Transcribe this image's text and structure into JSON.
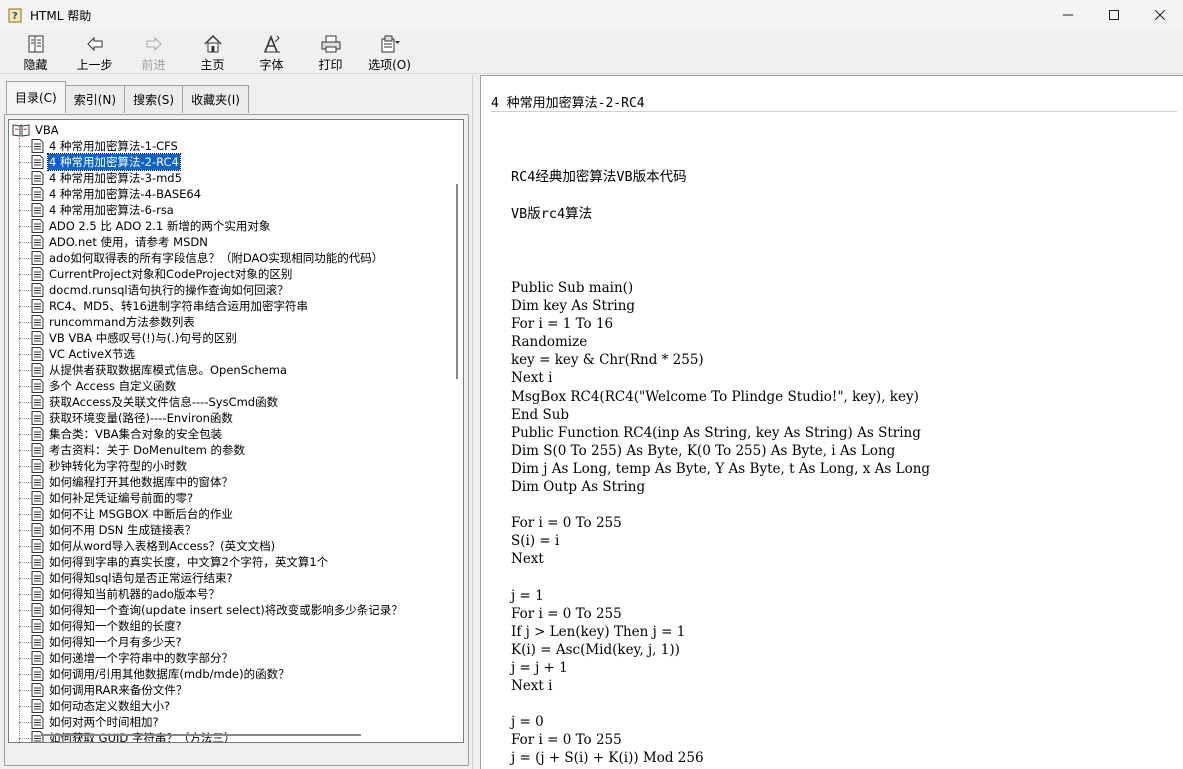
{
  "window": {
    "title": "HTML 帮助"
  },
  "toolbar": {
    "buttons": [
      {
        "label": "隐藏",
        "icon": "hide-icon",
        "enabled": true
      },
      {
        "label": "上一步",
        "icon": "back-arrow-icon",
        "enabled": true
      },
      {
        "label": "前进",
        "icon": "forward-arrow-icon",
        "enabled": false
      },
      {
        "label": "主页",
        "icon": "home-icon",
        "enabled": true
      },
      {
        "label": "字体",
        "icon": "font-icon",
        "enabled": true
      },
      {
        "label": "打印",
        "icon": "printer-icon",
        "enabled": true
      },
      {
        "label": "选项(O)",
        "icon": "options-icon",
        "enabled": true
      }
    ]
  },
  "nav_tabs": [
    {
      "label": "目录(C)",
      "active": true
    },
    {
      "label": "索引(N)",
      "active": false
    },
    {
      "label": "搜索(S)",
      "active": false
    },
    {
      "label": "收藏夹(I)",
      "active": false
    }
  ],
  "tree": {
    "root": "VBA",
    "items": [
      "4 种常用加密算法-1-CFS",
      "4 种常用加密算法-2-RC4",
      "4 种常用加密算法-3-md5",
      "4 种常用加密算法-4-BASE64",
      "4 种常用加密算法-6-rsa",
      "ADO 2.5 比 ADO 2.1 新增的两个实用对象",
      "ADO.net 使用，请参考 MSDN",
      "ado如何取得表的所有字段信息？（附DAO实现相同功能的代码）",
      "CurrentProject对象和CodeProject对象的区别",
      "docmd.runsql语句执行的操作查询如何回滚？",
      "RC4、MD5、转16进制字符串结合运用加密字符串",
      "runcommand方法参数列表",
      "VB VBA 中感叹号(!)与(.)句号的区别",
      "VC ActiveX节选",
      "从提供者获取数据库模式信息。OpenSchema",
      "多个 Access 自定义函数",
      "获取Access及关联文件信息----SysCmd函数",
      "获取环境变量(路径)----Environ函数",
      "集合类：VBA集合对象的安全包装",
      "考古资料：关于 DoMenuItem 的参数",
      "秒钟转化为字符型的小时数",
      "如何编程打开其他数据库中的窗体？",
      "如何补足凭证编号前面的零?",
      "如何不让 MSGBOX 中断后台的作业",
      "如何不用 DSN 生成链接表？",
      "如何从word导入表格到Access？(英文文档)",
      "如何得到字串的真实长度，中文算2个字符，英文算1个",
      "如何得知sql语句是否正常运行结束?",
      "如何得知当前机器的ado版本号？",
      "如何得知一个查询(update insert select)将改变或影响多少条记录？",
      "如何得知一个数组的长度?",
      "如何得知一个月有多少天?",
      "如何递增一个字符串中的数字部分？",
      "如何调用/引用其他数据库(mdb/mde)的函数？",
      "如何调用RAR来备份文件？",
      "如何动态定义数组大小?",
      "如何对两个时间相加?",
      "如何获取 GUID 字符串？（方法三）"
    ],
    "selected_index": 1
  },
  "topic": {
    "title": "4 种常用加密算法-2-RC4",
    "heading1": "RC4经典加密算法VB版本代码",
    "heading2": "VB版rc4算法",
    "code": "Public Sub main()\nDim key As String\nFor i = 1 To 16\nRandomize\nkey = key & Chr(Rnd * 255)\nNext i\nMsgBox RC4(RC4(\"Welcome To Plindge Studio!\", key), key)\nEnd Sub\nPublic Function RC4(inp As String, key As String) As String\nDim S(0 To 255) As Byte, K(0 To 255) As Byte, i As Long\nDim j As Long, temp As Byte, Y As Byte, t As Long, x As Long\nDim Outp As String\n\nFor i = 0 To 255\nS(i) = i\nNext\n\nj = 1\nFor i = 0 To 255\nIf j > Len(key) Then j = 1\nK(i) = Asc(Mid(key, j, 1))\nj = j + 1\nNext i\n\nj = 0\nFor i = 0 To 255\nj = (j + S(i) + K(i)) Mod 256"
  }
}
